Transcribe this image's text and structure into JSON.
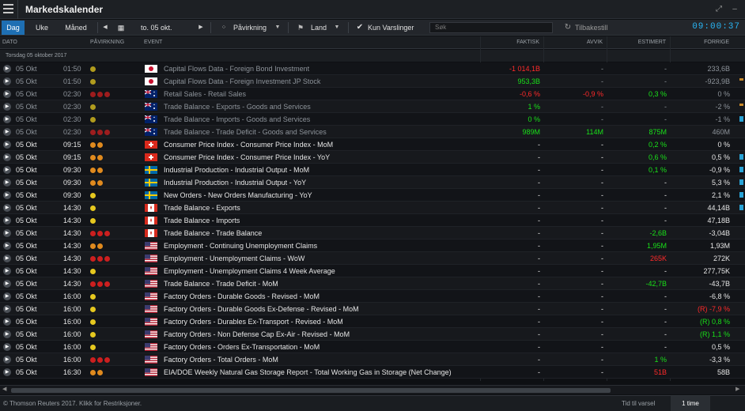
{
  "window": {
    "title": "Markedskalender"
  },
  "toolbar": {
    "tab_day": "Dag",
    "tab_week": "Uke",
    "tab_month": "Måned",
    "date": "to. 05 okt.",
    "impact": "Påvirkning",
    "country": "Land",
    "alerts_only": "Kun Varslinger",
    "search_placeholder": "Søk",
    "reset": "Tilbakestill",
    "clock": "09:00:37"
  },
  "columns": {
    "date": "DATO",
    "impact": "PÅVIRKNING",
    "event": "EVENT",
    "actual": "FAKTISK",
    "deviation": "AVVIK",
    "estimate": "ESTIMERT",
    "previous": "FORRIGE"
  },
  "group_label": "Torsdag 05 oktober 2017",
  "colors": {
    "accent": "#1e6fb3",
    "positive": "#19e019",
    "negative": "#ff2a2a",
    "impact_high": "#cc1f1f",
    "impact_medium": "#e08a1e",
    "impact_low": "#e6c81f",
    "clock": "#29b6f6"
  },
  "rows": [
    {
      "date": "05 Okt",
      "time": "01:50",
      "impact": 1,
      "flag": "jp",
      "event": "Capital Flows Data - Foreign Bond Investment",
      "actual": "-1 014,1B",
      "actual_tone": "neg",
      "deviation": "-",
      "dev_tone": "",
      "estimate": "-",
      "est_tone": "",
      "previous": "233,6B",
      "prev_tone": "",
      "past": true
    },
    {
      "date": "05 Okt",
      "time": "01:50",
      "impact": 1,
      "flag": "jp",
      "event": "Capital Flows Data - Foreign Investment JP Stock",
      "actual": "953,3B",
      "actual_tone": "pos",
      "deviation": "-",
      "dev_tone": "",
      "estimate": "-",
      "est_tone": "",
      "previous": "-923,9B",
      "prev_tone": "",
      "past": true
    },
    {
      "date": "05 Okt",
      "time": "02:30",
      "impact": 3,
      "flag": "au",
      "event": "Retail Sales - Retail Sales",
      "actual": "-0,6 %",
      "actual_tone": "neg",
      "deviation": "-0,9 %",
      "dev_tone": "neg",
      "estimate": "0,3 %",
      "est_tone": "pos",
      "previous": "0 %",
      "prev_tone": "",
      "past": true
    },
    {
      "date": "05 Okt",
      "time": "02:30",
      "impact": 1,
      "flag": "au",
      "event": "Trade Balance - Exports - Goods and Services",
      "actual": "1 %",
      "actual_tone": "pos",
      "deviation": "-",
      "dev_tone": "",
      "estimate": "-",
      "est_tone": "",
      "previous": "-2 %",
      "prev_tone": "",
      "past": true
    },
    {
      "date": "05 Okt",
      "time": "02:30",
      "impact": 1,
      "flag": "au",
      "event": "Trade Balance - Imports - Goods and Services",
      "actual": "0 %",
      "actual_tone": "pos",
      "deviation": "-",
      "dev_tone": "",
      "estimate": "-",
      "est_tone": "",
      "previous": "-1 %",
      "prev_tone": "",
      "past": true
    },
    {
      "date": "05 Okt",
      "time": "02:30",
      "impact": 3,
      "flag": "au",
      "event": "Trade Balance - Trade Deficit - Goods and Services",
      "actual": "989M",
      "actual_tone": "pos",
      "deviation": "114M",
      "dev_tone": "pos",
      "estimate": "875M",
      "est_tone": "pos",
      "previous": "460M",
      "prev_tone": "",
      "past": true
    },
    {
      "date": "05 Okt",
      "time": "09:15",
      "impact": 2,
      "flag": "ch",
      "event": "Consumer Price Index - Consumer Price Index - MoM",
      "actual": "-",
      "actual_tone": "",
      "deviation": "-",
      "dev_tone": "",
      "estimate": "0,2 %",
      "est_tone": "pos",
      "previous": "0 %",
      "prev_tone": "",
      "past": false
    },
    {
      "date": "05 Okt",
      "time": "09:15",
      "impact": 2,
      "flag": "ch",
      "event": "Consumer Price Index - Consumer Price Index - YoY",
      "actual": "-",
      "actual_tone": "",
      "deviation": "-",
      "dev_tone": "",
      "estimate": "0,6 %",
      "est_tone": "pos",
      "previous": "0,5 %",
      "prev_tone": "",
      "past": false
    },
    {
      "date": "05 Okt",
      "time": "09:30",
      "impact": 2,
      "flag": "se",
      "event": "Industrial Production - Industrial Output - MoM",
      "actual": "-",
      "actual_tone": "",
      "deviation": "-",
      "dev_tone": "",
      "estimate": "0,1 %",
      "est_tone": "pos",
      "previous": "-0,9 %",
      "prev_tone": "",
      "past": false
    },
    {
      "date": "05 Okt",
      "time": "09:30",
      "impact": 2,
      "flag": "se",
      "event": "Industrial Production - Industrial Output - YoY",
      "actual": "-",
      "actual_tone": "",
      "deviation": "-",
      "dev_tone": "",
      "estimate": "-",
      "est_tone": "",
      "previous": "5,3 %",
      "prev_tone": "",
      "past": false
    },
    {
      "date": "05 Okt",
      "time": "09:30",
      "impact": 1,
      "flag": "se",
      "event": "New Orders - New Orders Manufacturing - YoY",
      "actual": "-",
      "actual_tone": "",
      "deviation": "-",
      "dev_tone": "",
      "estimate": "-",
      "est_tone": "",
      "previous": "2,1 %",
      "prev_tone": "",
      "past": false
    },
    {
      "date": "05 Okt",
      "time": "14:30",
      "impact": 1,
      "flag": "ca",
      "event": "Trade Balance - Exports",
      "actual": "-",
      "actual_tone": "",
      "deviation": "-",
      "dev_tone": "",
      "estimate": "-",
      "est_tone": "",
      "previous": "44,14B",
      "prev_tone": "",
      "past": false
    },
    {
      "date": "05 Okt",
      "time": "14:30",
      "impact": 1,
      "flag": "ca",
      "event": "Trade Balance - Imports",
      "actual": "-",
      "actual_tone": "",
      "deviation": "-",
      "dev_tone": "",
      "estimate": "-",
      "est_tone": "",
      "previous": "47,18B",
      "prev_tone": "",
      "past": false
    },
    {
      "date": "05 Okt",
      "time": "14:30",
      "impact": 3,
      "flag": "ca",
      "event": "Trade Balance - Trade Balance",
      "actual": "-",
      "actual_tone": "",
      "deviation": "-",
      "dev_tone": "",
      "estimate": "-2,6B",
      "est_tone": "pos",
      "previous": "-3,04B",
      "prev_tone": "",
      "past": false
    },
    {
      "date": "05 Okt",
      "time": "14:30",
      "impact": 2,
      "flag": "us",
      "event": "Employment - Continuing Unemployment Claims",
      "actual": "-",
      "actual_tone": "",
      "deviation": "-",
      "dev_tone": "",
      "estimate": "1,95M",
      "est_tone": "pos",
      "previous": "1,93M",
      "prev_tone": "",
      "past": false
    },
    {
      "date": "05 Okt",
      "time": "14:30",
      "impact": 3,
      "flag": "us",
      "event": "Employment - Unemployment Claims - WoW",
      "actual": "-",
      "actual_tone": "",
      "deviation": "-",
      "dev_tone": "",
      "estimate": "265K",
      "est_tone": "neg",
      "previous": "272K",
      "prev_tone": "",
      "past": false
    },
    {
      "date": "05 Okt",
      "time": "14:30",
      "impact": 1,
      "flag": "us",
      "event": "Employment - Unemployment Claims 4 Week Average",
      "actual": "-",
      "actual_tone": "",
      "deviation": "-",
      "dev_tone": "",
      "estimate": "-",
      "est_tone": "",
      "previous": "277,75K",
      "prev_tone": "",
      "past": false
    },
    {
      "date": "05 Okt",
      "time": "14:30",
      "impact": 3,
      "flag": "us",
      "event": "Trade Balance - Trade Deficit - MoM",
      "actual": "-",
      "actual_tone": "",
      "deviation": "-",
      "dev_tone": "",
      "estimate": "-42,7B",
      "est_tone": "pos",
      "previous": "-43,7B",
      "prev_tone": "",
      "past": false
    },
    {
      "date": "05 Okt",
      "time": "16:00",
      "impact": 1,
      "flag": "us",
      "event": "Factory Orders - Durable Goods - Revised - MoM",
      "actual": "-",
      "actual_tone": "",
      "deviation": "-",
      "dev_tone": "",
      "estimate": "-",
      "est_tone": "",
      "previous": "-6,8 %",
      "prev_tone": "",
      "past": false
    },
    {
      "date": "05 Okt",
      "time": "16:00",
      "impact": 1,
      "flag": "us",
      "event": "Factory Orders - Durable Goods Ex-Defense - Revised - MoM",
      "actual": "-",
      "actual_tone": "",
      "deviation": "-",
      "dev_tone": "",
      "estimate": "-",
      "est_tone": "",
      "previous": "(R) -7,9 %",
      "prev_tone": "neg",
      "past": false
    },
    {
      "date": "05 Okt",
      "time": "16:00",
      "impact": 1,
      "flag": "us",
      "event": "Factory Orders - Durables Ex-Transport - Revised - MoM",
      "actual": "-",
      "actual_tone": "",
      "deviation": "-",
      "dev_tone": "",
      "estimate": "-",
      "est_tone": "",
      "previous": "(R) 0,8 %",
      "prev_tone": "pos",
      "past": false
    },
    {
      "date": "05 Okt",
      "time": "16:00",
      "impact": 1,
      "flag": "us",
      "event": "Factory Orders - Non Defense Cap Ex-Air - Revised - MoM",
      "actual": "-",
      "actual_tone": "",
      "deviation": "-",
      "dev_tone": "",
      "estimate": "-",
      "est_tone": "",
      "previous": "(R) 1,1 %",
      "prev_tone": "pos",
      "past": false
    },
    {
      "date": "05 Okt",
      "time": "16:00",
      "impact": 1,
      "flag": "us",
      "event": "Factory Orders - Orders Ex-Transportation - MoM",
      "actual": "-",
      "actual_tone": "",
      "deviation": "-",
      "dev_tone": "",
      "estimate": "-",
      "est_tone": "",
      "previous": "0,5 %",
      "prev_tone": "",
      "past": false
    },
    {
      "date": "05 Okt",
      "time": "16:00",
      "impact": 3,
      "flag": "us",
      "event": "Factory Orders - Total Orders - MoM",
      "actual": "-",
      "actual_tone": "",
      "deviation": "-",
      "dev_tone": "",
      "estimate": "1 %",
      "est_tone": "pos",
      "previous": "-3,3 %",
      "prev_tone": "",
      "past": false
    },
    {
      "date": "05 Okt",
      "time": "16:30",
      "impact": 2,
      "flag": "us",
      "event": "EIA/DOE Weekly Natural Gas Storage Report - Total Working Gas in Storage (Net Change)",
      "actual": "-",
      "actual_tone": "",
      "deviation": "-",
      "dev_tone": "",
      "estimate": "51B",
      "est_tone": "neg",
      "previous": "58B",
      "prev_tone": "",
      "past": false
    }
  ],
  "footer": {
    "copyright": "© Thomson Reuters 2017. Klikk for Restriksjoner.",
    "alert_label": "Tid til varsel",
    "alert_value": "1 time"
  }
}
